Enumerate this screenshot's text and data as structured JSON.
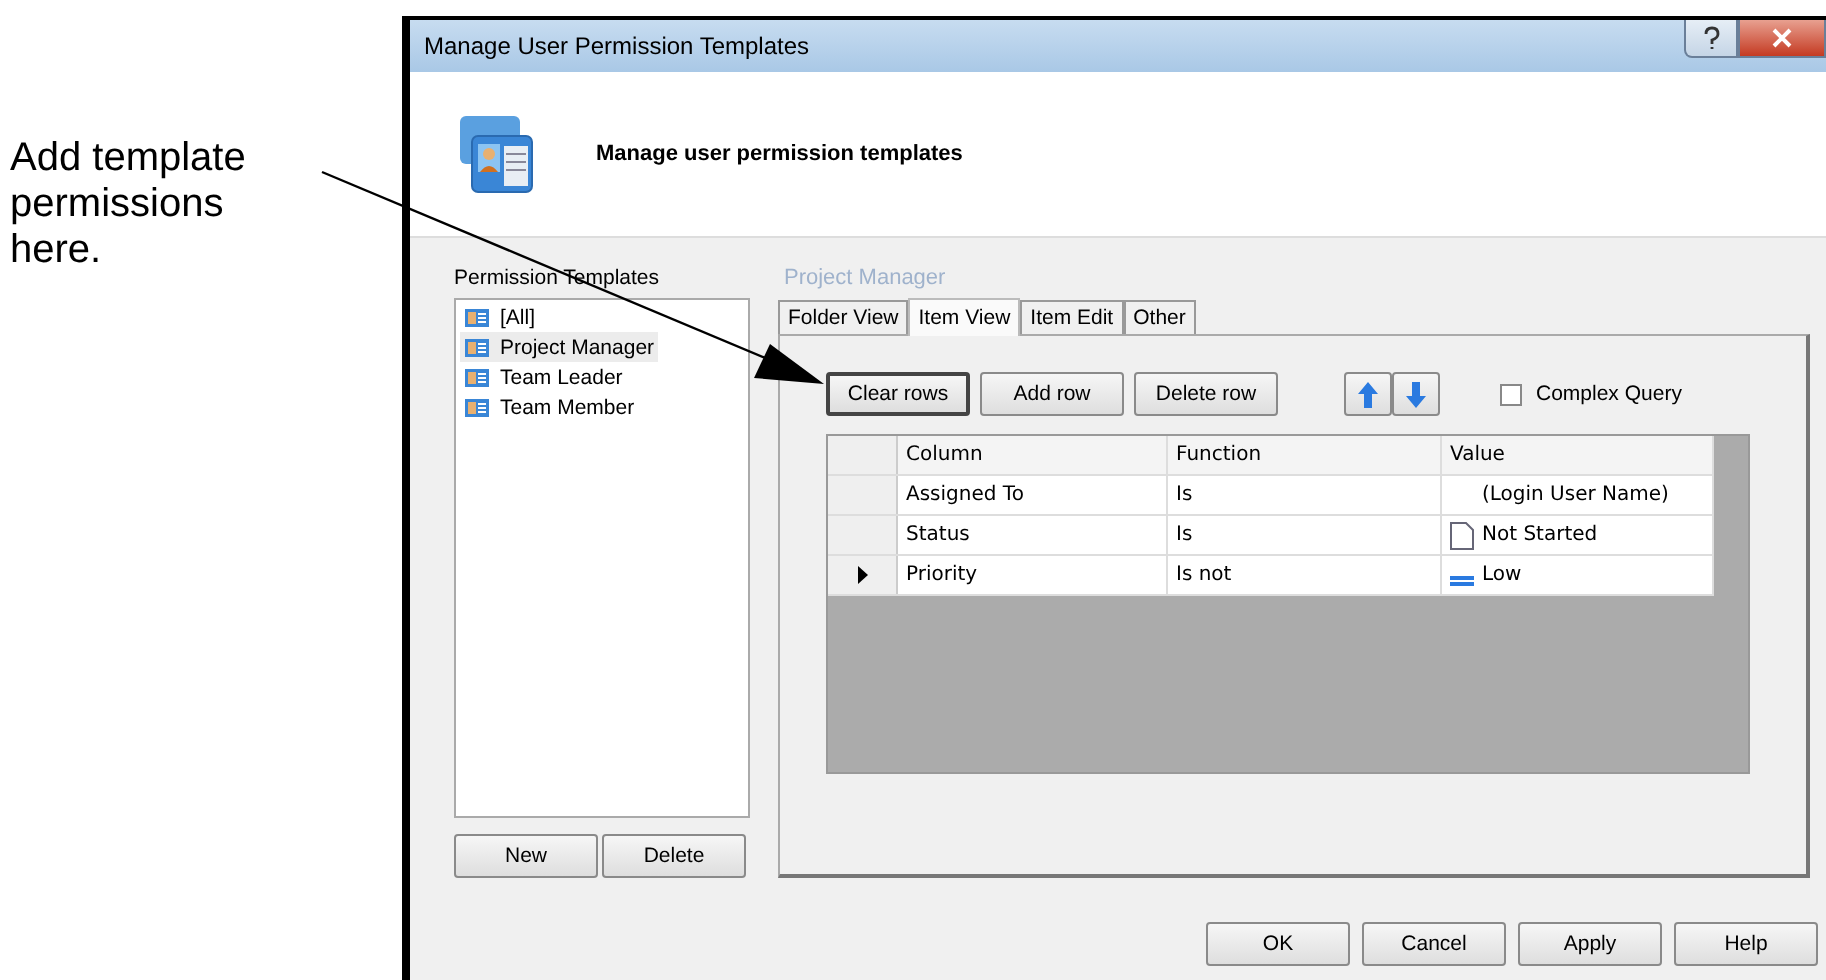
{
  "annotation": {
    "text": "Add template permissions here."
  },
  "window": {
    "title": "Manage User Permission Templates"
  },
  "header": {
    "title": "Manage user permission templates"
  },
  "templates": {
    "label": "Permission Templates",
    "items": [
      {
        "label": "[All]",
        "selected": false
      },
      {
        "label": "Project Manager",
        "selected": true
      },
      {
        "label": "Team Leader",
        "selected": false
      },
      {
        "label": "Team Member",
        "selected": false
      }
    ],
    "buttons": [
      "New",
      "Delete"
    ]
  },
  "detail": {
    "title": "Project Manager",
    "tabs": [
      {
        "label": "Folder View",
        "selected": false
      },
      {
        "label": "Item View",
        "selected": true
      },
      {
        "label": "Item Edit",
        "selected": false
      },
      {
        "label": "Other",
        "selected": false
      }
    ],
    "buttons": [
      "Clear rows",
      "Add row",
      "Delete row"
    ],
    "complex_query": {
      "label": "Complex Query",
      "checked": false
    },
    "grid": {
      "columns": [
        "Column",
        "Function",
        "Value"
      ],
      "rows": [
        {
          "current": false,
          "column": "Assigned To",
          "function": "Is",
          "value": "(Login User Name)",
          "kind": "plain"
        },
        {
          "current": false,
          "column": "Status",
          "function": "Is",
          "value": "Not Started",
          "kind": "document"
        },
        {
          "current": true,
          "column": "Priority",
          "function": "Is not",
          "value": "Low",
          "kind": "priority"
        }
      ]
    }
  },
  "footer_buttons": [
    "OK",
    "Cancel",
    "Apply",
    "Help"
  ]
}
